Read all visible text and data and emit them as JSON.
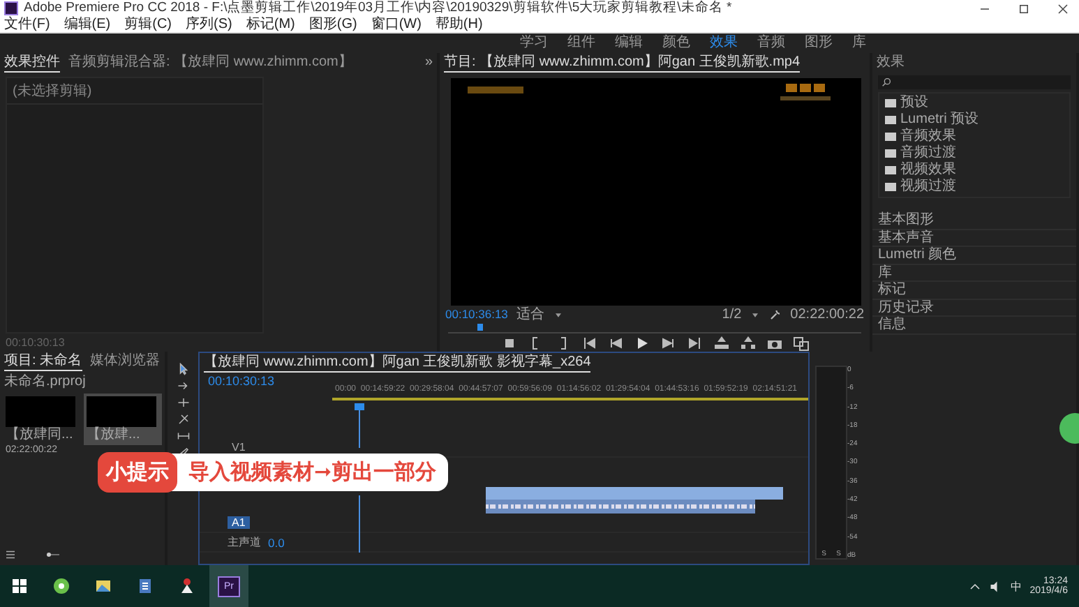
{
  "window": {
    "title": "Adobe Premiere Pro CC 2018 - F:\\点墨剪辑工作\\2019年03月工作\\内容\\20190329\\剪辑软件\\5大玩家剪辑教程\\未命名 *",
    "controls": [
      {
        "kind": "minimize"
      },
      {
        "kind": "maximize"
      },
      {
        "kind": "close"
      }
    ]
  },
  "menu": [
    "文件(F)",
    "编辑(E)",
    "剪辑(C)",
    "序列(S)",
    "标记(M)",
    "图形(G)",
    "窗口(W)",
    "帮助(H)"
  ],
  "workspaces": [
    {
      "label": "学习",
      "selected": false
    },
    {
      "label": "组件",
      "selected": false
    },
    {
      "label": "编辑",
      "selected": false
    },
    {
      "label": "颜色",
      "selected": false
    },
    {
      "label": "效果",
      "selected": true
    },
    {
      "label": "音频",
      "selected": false
    },
    {
      "label": "图形",
      "selected": false
    },
    {
      "label": "库",
      "selected": false
    }
  ],
  "effect_controls": {
    "tabs": [
      {
        "label": "效果控件",
        "selected": true
      },
      {
        "label": "音频剪辑混合器: 【放肆同 www.zhimm.com】",
        "selected": false
      }
    ],
    "more": "»",
    "empty_note": "(未选择剪辑)",
    "timecode": "00:10:30:13"
  },
  "program": {
    "title": "节目: 【放肆同 www.zhimm.com】阿gan 王俊凯新歌.mp4",
    "timecode": "00:10:36:13",
    "zoom": "适合",
    "resolution": "1/2",
    "duration": "02:22:00:22",
    "controls": [
      {
        "kind": "stop"
      },
      {
        "kind": "mark-in"
      },
      {
        "kind": "mark-out"
      },
      {
        "kind": "go-in"
      },
      {
        "kind": "step-back"
      },
      {
        "kind": "play"
      },
      {
        "kind": "step-forward"
      },
      {
        "kind": "go-out"
      },
      {
        "kind": "lift"
      },
      {
        "kind": "extract"
      },
      {
        "kind": "camera"
      },
      {
        "kind": "compare"
      }
    ]
  },
  "effects": {
    "title": "效果",
    "folders": [
      "预设",
      "Lumetri 预设",
      "音频效果",
      "音频过渡",
      "视频效果",
      "视频过渡"
    ],
    "sections": [
      "基本图形",
      "基本声音",
      "Lumetri 颜色",
      "库",
      "标记",
      "历史记录",
      "信息"
    ]
  },
  "project": {
    "tabs": [
      {
        "label": "项目: 未命名",
        "selected": true
      },
      {
        "label": "媒体浏览器",
        "selected": false
      }
    ],
    "file": "未命名.prproj",
    "clips": [
      {
        "name": "【放肆同...",
        "duration": "02:22:00:22",
        "selected": false
      },
      {
        "name": "【放肆...",
        "selected": true
      }
    ]
  },
  "timeline": {
    "title": "【放肆同 www.zhimm.com】阿gan 王俊凯新歌 影视字幕_x264",
    "timecode": "00:10:30:13",
    "ruler": [
      "00:00",
      "00:14:59:22",
      "00:29:58:04",
      "00:44:57:07",
      "00:59:56:09",
      "01:14:56:02",
      "01:29:54:04",
      "01:44:53:16",
      "01:59:52:19",
      "02:14:51:21"
    ],
    "tracks": [
      {
        "kind": "video",
        "name": "V1"
      },
      {
        "kind": "audio",
        "name": "A1"
      },
      {
        "kind": "master",
        "name": "主声道",
        "value": "0.0"
      }
    ]
  },
  "meter": {
    "scale": [
      "0",
      "-6",
      "-12",
      "-18",
      "-24",
      "-30",
      "-36",
      "-42",
      "-48",
      "-54",
      "dB"
    ],
    "channels": [
      "S",
      "S"
    ]
  },
  "tip": {
    "badge": "小提示",
    "text": "导入视频素材➞剪出一部分"
  },
  "taskbar": {
    "apps": [
      {
        "kind": "start"
      },
      {
        "kind": "browser"
      },
      {
        "kind": "photos"
      },
      {
        "kind": "document"
      },
      {
        "kind": "figure"
      },
      {
        "kind": "premiere",
        "label": "Pr"
      }
    ],
    "ime": "中",
    "time": "13:24",
    "date": "2019/4/6"
  }
}
